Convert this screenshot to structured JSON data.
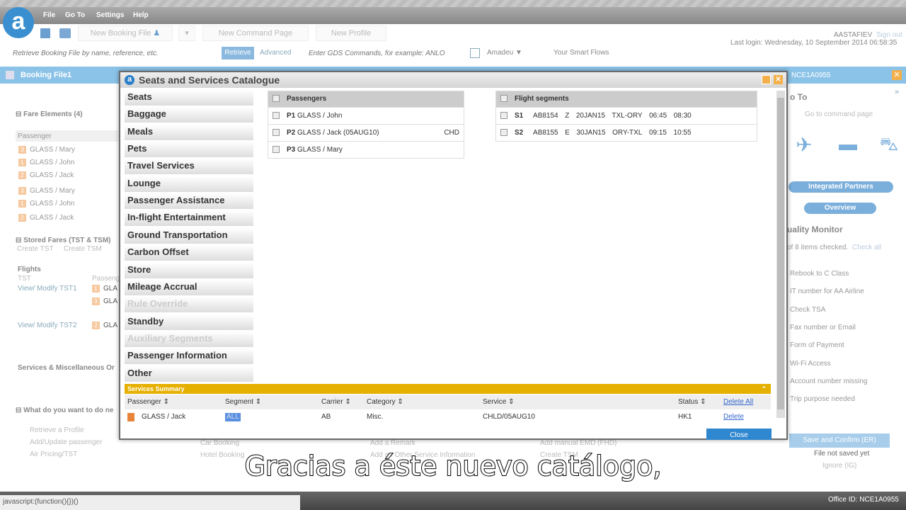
{
  "menu": {
    "file": "File",
    "goto": "Go To",
    "settings": "Settings",
    "help": "Help"
  },
  "toolbar": {
    "new_booking": "New Booking File",
    "new_command": "New Command Page",
    "new_profile": "New Profile",
    "retrieve_placeholder": "Retrieve Booking File by name, reference, etc.",
    "retrieve": "Retrieve",
    "advanced": "Advanced",
    "gds_placeholder": "Enter GDS Commands, for example: ANLO",
    "gds_select": "Amadeu",
    "smart_flows": "Your Smart Flows",
    "user": "AASTAFIEV",
    "sign_out": "Sign out",
    "last_login": "Last login: Wednesday, 10 September 2014 06:58:35"
  },
  "left": {
    "tab": "Booking File1",
    "fare_elements": "Fare Elements (4)",
    "passenger_col": "Passenger",
    "fare_pax": [
      {
        "n": "3",
        "name": "GLASS / Mary"
      },
      {
        "n": "1",
        "name": "GLASS / John"
      },
      {
        "n": "2",
        "name": "GLASS / Jack"
      },
      {
        "n": "3",
        "name": "GLASS / Mary"
      },
      {
        "n": "1",
        "name": "GLASS / John"
      },
      {
        "n": "2",
        "name": "GLASS / Jack"
      }
    ],
    "stored_fares": "Stored Fares (TST & TSM)",
    "create_tst": "Create TST",
    "create_tsm": "Create TSM",
    "flights": "Flights",
    "tst": "TST",
    "passenger_short": "Passeng",
    "tst1": "View/ Modify TST1",
    "tst2": "View/ Modify TST2",
    "gla": "GLA",
    "services": "Services & Miscellaneous Or",
    "next": "What do you want to do ne",
    "actions": [
      "Retrieve a Profile",
      "Add/Update passenger",
      "Air Pricing/TST"
    ],
    "actions2": [
      "Car Booking",
      "Hotel Booking"
    ],
    "actions3": [
      "Add a Remark",
      "Add an Other Service Information"
    ],
    "actions4": [
      "Add manual EMD (FHD)",
      "Create TSM"
    ]
  },
  "dialog": {
    "title": "Seats and Services Catalogue",
    "categories": [
      {
        "label": "Seats"
      },
      {
        "label": "Baggage"
      },
      {
        "label": "Meals"
      },
      {
        "label": "Pets"
      },
      {
        "label": "Travel Services"
      },
      {
        "label": "Lounge"
      },
      {
        "label": "Passenger Assistance"
      },
      {
        "label": "In-flight Entertainment"
      },
      {
        "label": "Ground Transportation"
      },
      {
        "label": "Carbon Offset"
      },
      {
        "label": "Store"
      },
      {
        "label": "Mileage Accrual"
      },
      {
        "label": "Rule Override",
        "disabled": true
      },
      {
        "label": "Standby"
      },
      {
        "label": "Auxiliary Segments",
        "disabled": true
      },
      {
        "label": "Passenger Information"
      },
      {
        "label": "Other"
      }
    ],
    "passengers_header": "Passengers",
    "passengers": [
      {
        "id": "P1",
        "name": "GLASS / John",
        "type": ""
      },
      {
        "id": "P2",
        "name": "GLASS / Jack (05AUG10)",
        "type": "CHD"
      },
      {
        "id": "P3",
        "name": "GLASS / Mary",
        "type": ""
      }
    ],
    "segments_header": "Flight segments",
    "segments": [
      {
        "id": "S1",
        "flight": "AB8154",
        "cls": "Z",
        "date": "20JAN15",
        "route": "TXL-ORY",
        "dep": "06:45",
        "arr": "08:30"
      },
      {
        "id": "S2",
        "flight": "AB8155",
        "cls": "E",
        "date": "30JAN15",
        "route": "ORY-TXL",
        "dep": "09:15",
        "arr": "10:55"
      }
    ],
    "summary": {
      "title": "Services Summary",
      "headers": {
        "passenger": "Passenger",
        "segment": "Segment",
        "carrier": "Carrier",
        "category": "Category",
        "service": "Service",
        "status": "Status"
      },
      "delete_all": "Delete All",
      "row": {
        "passenger": "GLASS / Jack",
        "segment": "ALL",
        "carrier": "AB",
        "category": "Misc.",
        "service": "CHLD/05AUG10",
        "status": "HK1",
        "delete": "Delete"
      }
    },
    "close": "Close"
  },
  "right": {
    "office": "NCE1A0955",
    "goto": "o To",
    "command_page": "Go to command page",
    "partners": "Integrated Partners",
    "overview": "Overview",
    "quality": "uality Monitor",
    "checked": "of 8 items checked.",
    "check_all": "Check all",
    "items": [
      "Rebook to C Class",
      "IT number for AA Airline",
      "Check TSA",
      "Fax number or Email",
      "Form of Payment",
      "Wi-Fi Access",
      "Account number missing",
      "Trip purpose needed"
    ],
    "save": "Save and Confirm (ER)",
    "not_saved": "File not saved yet",
    "ignore": "Ignore (IG)"
  },
  "status": {
    "url": "javascript:(function(){})()",
    "office_id": "Office ID: NCE1A0955"
  },
  "subtitle": "Gracias a éste nuevo catálogo,"
}
